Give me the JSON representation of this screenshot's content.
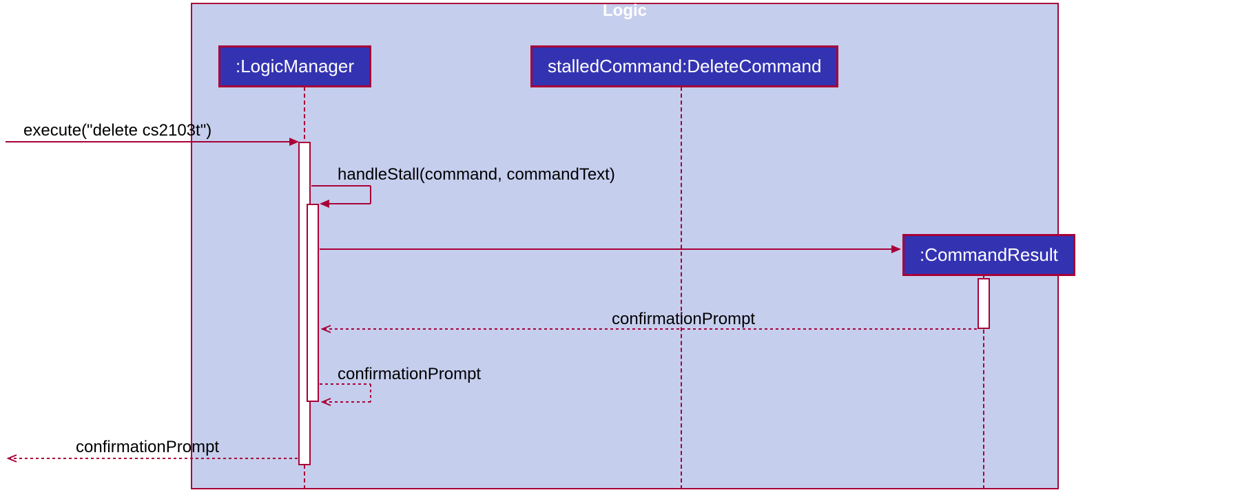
{
  "frame": {
    "label": "Logic"
  },
  "participants": {
    "logicManager": ":LogicManager",
    "stalledCommand": "stalledCommand:DeleteCommand",
    "commandResult": ":CommandResult"
  },
  "messages": {
    "execute": "execute(\"delete cs2103t\")",
    "handleStall": "handleStall(command, commandText)",
    "confirmationPrompt1": "confirmationPrompt",
    "confirmationPrompt2": "confirmationPrompt",
    "confirmationPrompt3": "confirmationPrompt"
  },
  "colors": {
    "frameBg": "#C5CEED",
    "border": "#A80036",
    "participantBg": "#3333B2"
  }
}
